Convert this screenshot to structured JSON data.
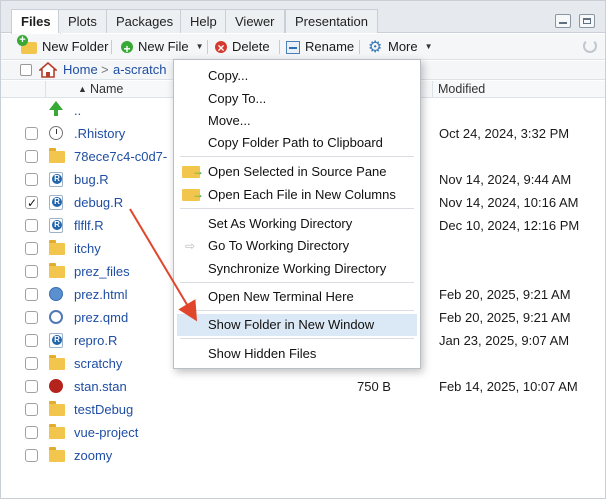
{
  "tabs": [
    "Files",
    "Plots",
    "Packages",
    "Help",
    "Viewer",
    "Presentation"
  ],
  "toolbar": {
    "new_folder": "New Folder",
    "new_file": "New File",
    "delete": "Delete",
    "rename": "Rename",
    "more": "More"
  },
  "breadcrumb": {
    "home": "Home",
    "folder": "a-scratch"
  },
  "header": {
    "name": "Name",
    "modified": "Modified",
    "sort_arrow": "▲"
  },
  "files": [
    {
      "name": "..",
      "icon": "parent-folder-icon",
      "checked": false,
      "size": "",
      "modified": ""
    },
    {
      "name": ".Rhistory",
      "icon": "rhistory-icon",
      "checked": false,
      "size": "",
      "modified": "Oct 24, 2024, 3:32 PM"
    },
    {
      "name": "78ece7c4-c0d7-",
      "icon": "folder-icon",
      "checked": false,
      "size": "",
      "modified": ""
    },
    {
      "name": "bug.R",
      "icon": "r-file-icon",
      "checked": false,
      "size": "",
      "modified": "Nov 14, 2024, 9:44 AM"
    },
    {
      "name": "debug.R",
      "icon": "r-file-icon",
      "checked": true,
      "size": "",
      "modified": "Nov 14, 2024, 10:16 AM"
    },
    {
      "name": "flflf.R",
      "icon": "r-file-icon",
      "checked": false,
      "size": "",
      "modified": "Dec 10, 2024, 12:16 PM"
    },
    {
      "name": "itchy",
      "icon": "folder-icon",
      "checked": false,
      "size": "",
      "modified": ""
    },
    {
      "name": "prez_files",
      "icon": "folder-icon",
      "checked": false,
      "size": "",
      "modified": ""
    },
    {
      "name": "prez.html",
      "icon": "html-file-icon",
      "checked": false,
      "size": "",
      "modified": "Feb 20, 2025, 9:21 AM"
    },
    {
      "name": "prez.qmd",
      "icon": "quarto-file-icon",
      "checked": false,
      "size": "",
      "modified": "Feb 20, 2025, 9:21 AM"
    },
    {
      "name": "repro.R",
      "icon": "r-file-icon",
      "checked": false,
      "size": "",
      "modified": "Jan 23, 2025, 9:07 AM"
    },
    {
      "name": "scratchy",
      "icon": "folder-icon",
      "checked": false,
      "size": "",
      "modified": ""
    },
    {
      "name": "stan.stan",
      "icon": "stan-file-icon",
      "checked": false,
      "size": "750 B",
      "modified": "Feb 14, 2025, 10:07 AM"
    },
    {
      "name": "testDebug",
      "icon": "folder-icon",
      "checked": false,
      "size": "",
      "modified": ""
    },
    {
      "name": "vue-project",
      "icon": "folder-icon",
      "checked": false,
      "size": "",
      "modified": ""
    },
    {
      "name": "zoomy",
      "icon": "folder-icon",
      "checked": false,
      "size": "",
      "modified": ""
    }
  ],
  "menu": {
    "copy": "Copy...",
    "copy_to": "Copy To...",
    "move": "Move...",
    "copy_path": "Copy Folder Path to Clipboard",
    "open_source": "Open Selected in Source Pane",
    "open_columns": "Open Each File in New Columns",
    "set_wd": "Set As Working Directory",
    "go_wd": "Go To Working Directory",
    "sync_wd": "Synchronize Working Directory",
    "terminal": "Open New Terminal Here",
    "show_window": "Show Folder in New Window",
    "hidden": "Show Hidden Files"
  },
  "colors": {
    "link": "#1f4ea3",
    "highlight": "#dbe8f5",
    "annotation_arrow": "#e0462c"
  }
}
